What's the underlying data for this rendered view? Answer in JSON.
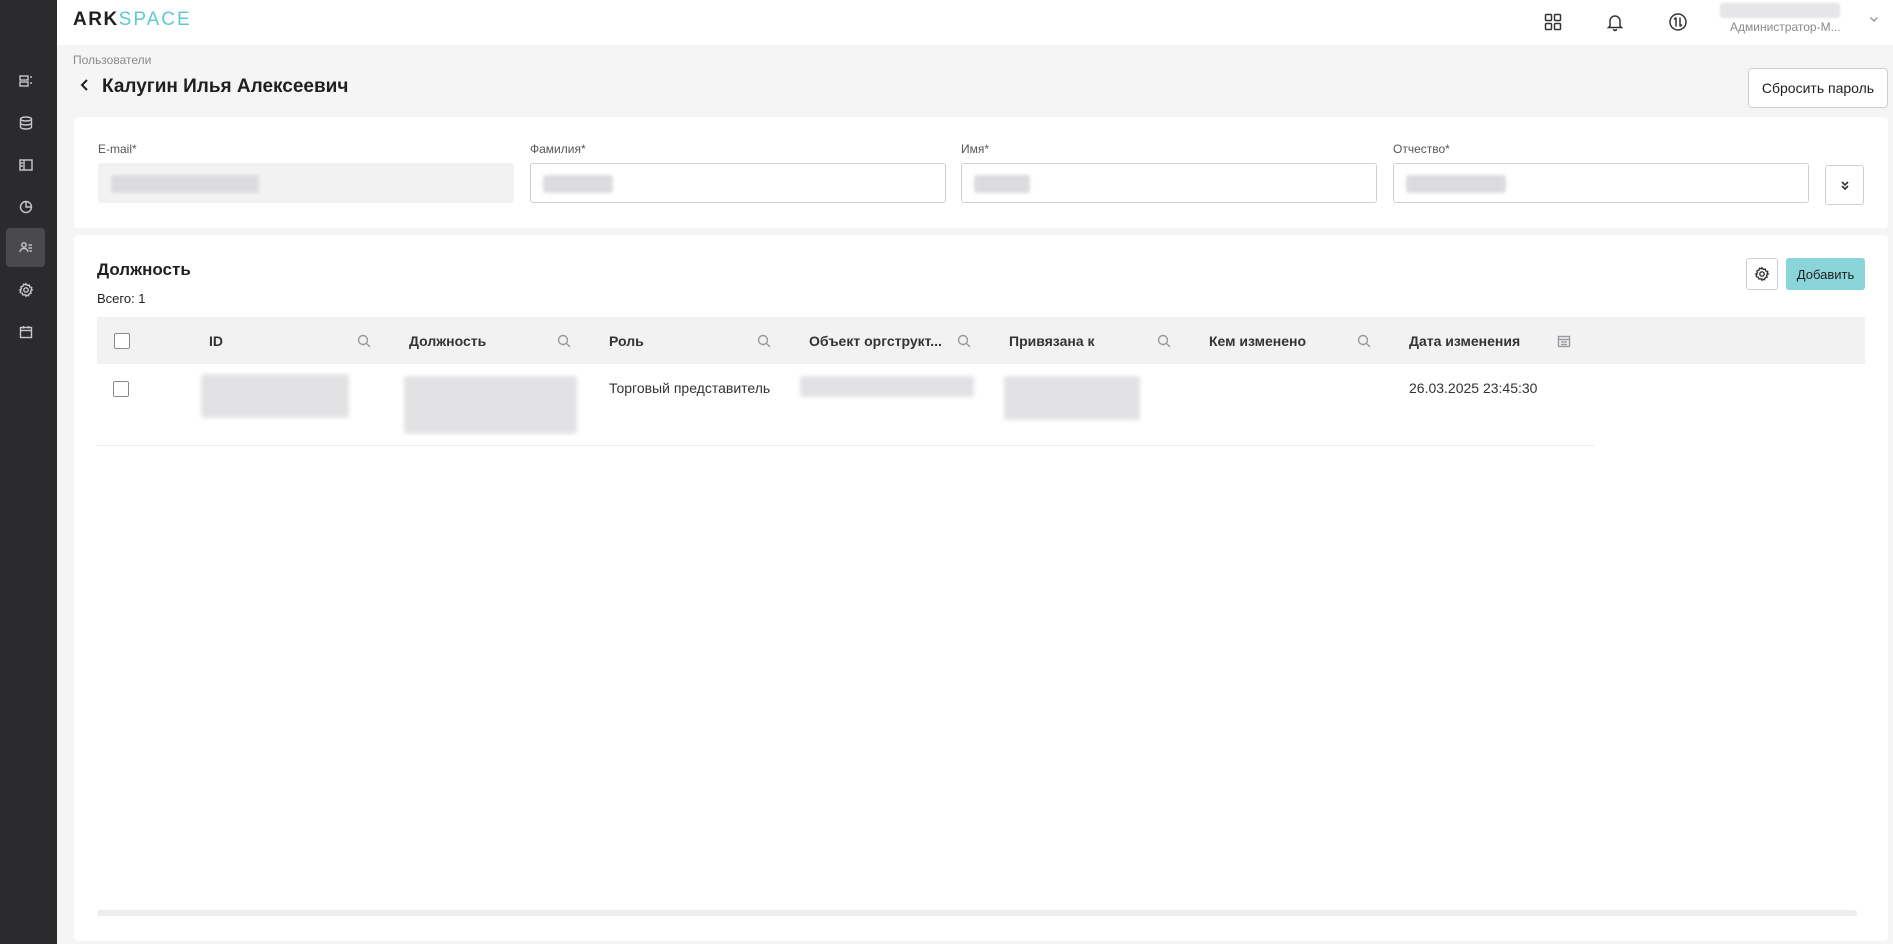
{
  "brand": {
    "part1": "ARK",
    "part2": "SPACE",
    "accent": "#5fc8d0"
  },
  "sidebar": {
    "items": [
      {
        "icon": "list-icon"
      },
      {
        "icon": "database-icon"
      },
      {
        "icon": "layout-icon"
      },
      {
        "icon": "pie-chart-icon"
      },
      {
        "icon": "users-icon",
        "active": true
      },
      {
        "icon": "gear-icon"
      },
      {
        "icon": "calendar-icon"
      }
    ]
  },
  "topbar": {
    "icons": [
      "apps-grid-icon",
      "bell-icon",
      "sync-icon"
    ],
    "user_role": "Администратор-М..."
  },
  "breadcrumb": "Пользователи",
  "page_title": "Калугин Илья Алексеевич",
  "reset_password_label": "Сбросить пароль",
  "form": {
    "email_label": "E-mail*",
    "lastname_label": "Фамилия*",
    "firstname_label": "Имя*",
    "middlename_label": "Отчество*"
  },
  "positions": {
    "title": "Должность",
    "total": "Всего: 1",
    "add_label": "Добавить",
    "columns": [
      "ID",
      "Должность",
      "Роль",
      "Объект оргструкт...",
      "Привязана к",
      "Кем изменено",
      "Дата изменения"
    ],
    "rows": [
      {
        "role": "Торговый представитель",
        "changed_at": "26.03.2025 23:45:30"
      }
    ]
  }
}
